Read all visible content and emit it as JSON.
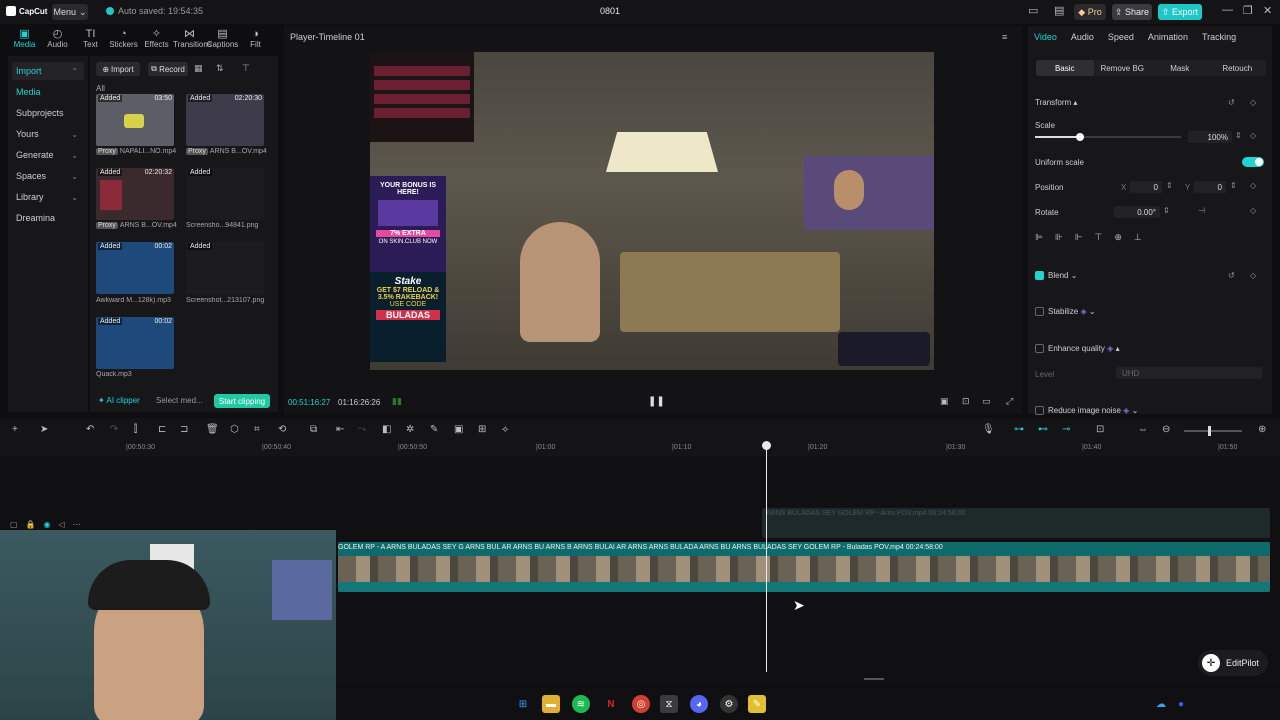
{
  "titlebar": {
    "logo": "CapCut",
    "menu": "Menu",
    "autosave": "Auto saved: 19:54:35",
    "project": "0801",
    "pro": "Pro",
    "share": "Share",
    "export": "Export"
  },
  "tooltabs": [
    {
      "label": "Media",
      "icon": "media-icon",
      "glyph": "▣"
    },
    {
      "label": "Audio",
      "icon": "audio-icon",
      "glyph": "◴"
    },
    {
      "label": "Text",
      "icon": "text-icon",
      "glyph": "TI"
    },
    {
      "label": "Stickers",
      "icon": "sticker-icon",
      "glyph": "◔"
    },
    {
      "label": "Effects",
      "icon": "effects-icon",
      "glyph": "✧"
    },
    {
      "label": "Transitions",
      "icon": "transition-icon",
      "glyph": "⋈"
    },
    {
      "label": "Captions",
      "icon": "captions-icon",
      "glyph": "▤"
    },
    {
      "label": "Filt",
      "icon": "filter-icon",
      "glyph": "◑"
    }
  ],
  "leftnav": {
    "import": "Import",
    "media": "Media",
    "subprojects": "Subprojects",
    "yours": "Yours",
    "generate": "Generate",
    "spaces": "Spaces",
    "library": "Library",
    "dreamina": "Dreamina"
  },
  "media": {
    "import_btn": "Import",
    "record_btn": "Record",
    "all": "All",
    "items": [
      {
        "tag": "Added",
        "dur": "03:50",
        "name": "NAPALI...NO.mp4",
        "proxy": "Proxy"
      },
      {
        "tag": "Added",
        "dur": "02:20:30",
        "name": "ARNS B...OV.mp4",
        "proxy": "Proxy"
      },
      {
        "tag": "Added",
        "dur": "02:20:32",
        "name": "ARNS B...OV.mp4",
        "proxy": "Proxy"
      },
      {
        "tag": "Added",
        "dur": "",
        "name": "Screensho...94841.png",
        "proxy": ""
      },
      {
        "tag": "Added",
        "dur": "00:02",
        "name": "Awkward M...128k).mp3",
        "proxy": ""
      },
      {
        "tag": "Added",
        "dur": "",
        "name": "Screenshot...213107.png",
        "proxy": ""
      },
      {
        "tag": "Added",
        "dur": "00:02",
        "name": "Quack.mp3",
        "proxy": ""
      }
    ],
    "ai_clipper": "AI clipper",
    "select_media": "Select med...",
    "start_clipping": "Start clipping"
  },
  "player": {
    "title": "Player-Timeline 01",
    "current_time": "00:51:16:27",
    "total_time": "01:16:26:26",
    "overlay_bonus": "YOUR BONUS IS HERE!",
    "overlay_extra": "7% EXTRA",
    "overlay_site": "ON SKIN.CLUB NOW",
    "overlay_stake": "Stake",
    "overlay_reload": "GET $7 RELOAD & 3.5% RAKEBACK!",
    "overlay_code_label": "USE CODE",
    "overlay_code": "BULADAS"
  },
  "inspector": {
    "tabs": [
      "Video",
      "Audio",
      "Speed",
      "Animation",
      "Tracking"
    ],
    "subtabs": [
      "Basic",
      "Remove BG",
      "Mask",
      "Retouch"
    ],
    "transform": "Transform",
    "scale_label": "Scale",
    "scale_value": "100%",
    "scale_fraction": 0.31,
    "uniform_scale": "Uniform scale",
    "position_label": "Position",
    "pos_x_label": "X",
    "pos_x": "0",
    "pos_y_label": "Y",
    "pos_y": "0",
    "rotate_label": "Rotate",
    "rotate_value": "0.00°",
    "blend": "Blend",
    "stabilize": "Stabilize",
    "enhance_quality": "Enhance quality",
    "level_label": "Level",
    "level_value": "UHD",
    "reduce_noise": "Reduce image noise"
  },
  "timeline": {
    "ticks": [
      "|00:50:30",
      "|00:50:40",
      "|00:50:50",
      "|01:00",
      "|01:10",
      "|01:20",
      "|01:30",
      "|01:40",
      "|01:50"
    ],
    "ghost_label": "ARNS BULADAS SEY GOLEM RP - Arns POV.mp4   00:24:58:00",
    "clip_label": "GOLEM RP - A  ARNS BULADAS SEY G  ARNS BUL  AR  ARNS BU  ARNS B  ARNS BULAI    AR  ARNS  ARNS BULADA  ARNS BU  ARNS BULADAS SEY GOLEM RP - Buladas  POV.mp4   00:24:58:00",
    "editpilot": "EditPilot"
  },
  "colors": {
    "accent": "#23d3d3",
    "export": "#1fc7c7",
    "clip": "#0f6b6b"
  }
}
